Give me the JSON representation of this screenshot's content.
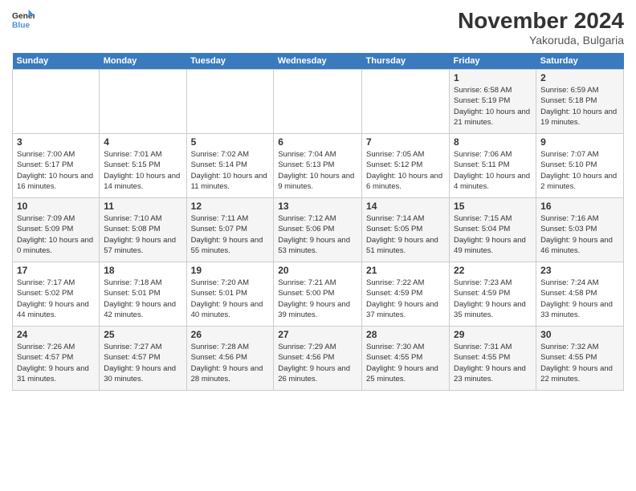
{
  "header": {
    "logo_line1": "General",
    "logo_line2": "Blue",
    "month": "November 2024",
    "location": "Yakoruda, Bulgaria"
  },
  "weekdays": [
    "Sunday",
    "Monday",
    "Tuesday",
    "Wednesday",
    "Thursday",
    "Friday",
    "Saturday"
  ],
  "weeks": [
    [
      {
        "day": "",
        "detail": ""
      },
      {
        "day": "",
        "detail": ""
      },
      {
        "day": "",
        "detail": ""
      },
      {
        "day": "",
        "detail": ""
      },
      {
        "day": "",
        "detail": ""
      },
      {
        "day": "1",
        "detail": "Sunrise: 6:58 AM\nSunset: 5:19 PM\nDaylight: 10 hours\nand 21 minutes."
      },
      {
        "day": "2",
        "detail": "Sunrise: 6:59 AM\nSunset: 5:18 PM\nDaylight: 10 hours\nand 19 minutes."
      }
    ],
    [
      {
        "day": "3",
        "detail": "Sunrise: 7:00 AM\nSunset: 5:17 PM\nDaylight: 10 hours\nand 16 minutes."
      },
      {
        "day": "4",
        "detail": "Sunrise: 7:01 AM\nSunset: 5:15 PM\nDaylight: 10 hours\nand 14 minutes."
      },
      {
        "day": "5",
        "detail": "Sunrise: 7:02 AM\nSunset: 5:14 PM\nDaylight: 10 hours\nand 11 minutes."
      },
      {
        "day": "6",
        "detail": "Sunrise: 7:04 AM\nSunset: 5:13 PM\nDaylight: 10 hours\nand 9 minutes."
      },
      {
        "day": "7",
        "detail": "Sunrise: 7:05 AM\nSunset: 5:12 PM\nDaylight: 10 hours\nand 6 minutes."
      },
      {
        "day": "8",
        "detail": "Sunrise: 7:06 AM\nSunset: 5:11 PM\nDaylight: 10 hours\nand 4 minutes."
      },
      {
        "day": "9",
        "detail": "Sunrise: 7:07 AM\nSunset: 5:10 PM\nDaylight: 10 hours\nand 2 minutes."
      }
    ],
    [
      {
        "day": "10",
        "detail": "Sunrise: 7:09 AM\nSunset: 5:09 PM\nDaylight: 10 hours\nand 0 minutes."
      },
      {
        "day": "11",
        "detail": "Sunrise: 7:10 AM\nSunset: 5:08 PM\nDaylight: 9 hours\nand 57 minutes."
      },
      {
        "day": "12",
        "detail": "Sunrise: 7:11 AM\nSunset: 5:07 PM\nDaylight: 9 hours\nand 55 minutes."
      },
      {
        "day": "13",
        "detail": "Sunrise: 7:12 AM\nSunset: 5:06 PM\nDaylight: 9 hours\nand 53 minutes."
      },
      {
        "day": "14",
        "detail": "Sunrise: 7:14 AM\nSunset: 5:05 PM\nDaylight: 9 hours\nand 51 minutes."
      },
      {
        "day": "15",
        "detail": "Sunrise: 7:15 AM\nSunset: 5:04 PM\nDaylight: 9 hours\nand 49 minutes."
      },
      {
        "day": "16",
        "detail": "Sunrise: 7:16 AM\nSunset: 5:03 PM\nDaylight: 9 hours\nand 46 minutes."
      }
    ],
    [
      {
        "day": "17",
        "detail": "Sunrise: 7:17 AM\nSunset: 5:02 PM\nDaylight: 9 hours\nand 44 minutes."
      },
      {
        "day": "18",
        "detail": "Sunrise: 7:18 AM\nSunset: 5:01 PM\nDaylight: 9 hours\nand 42 minutes."
      },
      {
        "day": "19",
        "detail": "Sunrise: 7:20 AM\nSunset: 5:01 PM\nDaylight: 9 hours\nand 40 minutes."
      },
      {
        "day": "20",
        "detail": "Sunrise: 7:21 AM\nSunset: 5:00 PM\nDaylight: 9 hours\nand 39 minutes."
      },
      {
        "day": "21",
        "detail": "Sunrise: 7:22 AM\nSunset: 4:59 PM\nDaylight: 9 hours\nand 37 minutes."
      },
      {
        "day": "22",
        "detail": "Sunrise: 7:23 AM\nSunset: 4:59 PM\nDaylight: 9 hours\nand 35 minutes."
      },
      {
        "day": "23",
        "detail": "Sunrise: 7:24 AM\nSunset: 4:58 PM\nDaylight: 9 hours\nand 33 minutes."
      }
    ],
    [
      {
        "day": "24",
        "detail": "Sunrise: 7:26 AM\nSunset: 4:57 PM\nDaylight: 9 hours\nand 31 minutes."
      },
      {
        "day": "25",
        "detail": "Sunrise: 7:27 AM\nSunset: 4:57 PM\nDaylight: 9 hours\nand 30 minutes."
      },
      {
        "day": "26",
        "detail": "Sunrise: 7:28 AM\nSunset: 4:56 PM\nDaylight: 9 hours\nand 28 minutes."
      },
      {
        "day": "27",
        "detail": "Sunrise: 7:29 AM\nSunset: 4:56 PM\nDaylight: 9 hours\nand 26 minutes."
      },
      {
        "day": "28",
        "detail": "Sunrise: 7:30 AM\nSunset: 4:55 PM\nDaylight: 9 hours\nand 25 minutes."
      },
      {
        "day": "29",
        "detail": "Sunrise: 7:31 AM\nSunset: 4:55 PM\nDaylight: 9 hours\nand 23 minutes."
      },
      {
        "day": "30",
        "detail": "Sunrise: 7:32 AM\nSunset: 4:55 PM\nDaylight: 9 hours\nand 22 minutes."
      }
    ]
  ]
}
